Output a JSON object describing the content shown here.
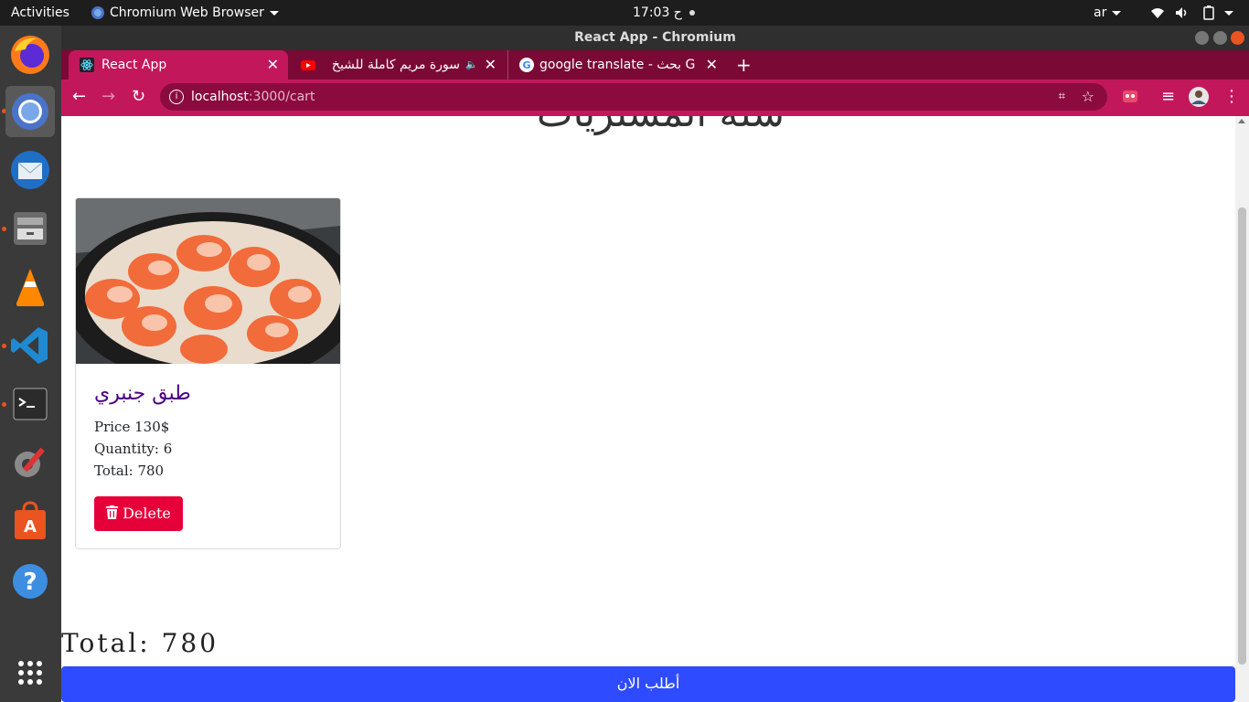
{
  "system": {
    "activities": "Activities",
    "app_menu": "Chromium Web Browser",
    "clock": "17:03 ح",
    "lang": "ar"
  },
  "window": {
    "title": "React App - Chromium"
  },
  "tabs": [
    {
      "label": "React App",
      "active": true
    },
    {
      "label": "سورة مريم كاملة للشيخ",
      "active": false
    },
    {
      "label": "google translate - بحث Go",
      "active": false
    }
  ],
  "address": {
    "host": "localhost",
    "path": ":3000/cart"
  },
  "page": {
    "heading_partial": "سلة المشتريات",
    "item": {
      "title": "طبق جنبري",
      "price": "Price 130$",
      "quantity": "Quantity: 6",
      "total": "Total: 780",
      "delete_label": "Delete"
    },
    "grand_total": "Total: 780",
    "order_label": "أطلب الان"
  },
  "colors": {
    "tab_bar": "#7a0a35",
    "toolbar": "#c2185b",
    "delete": "#e6003a",
    "order": "#2f4bff",
    "title": "#4b0082"
  }
}
